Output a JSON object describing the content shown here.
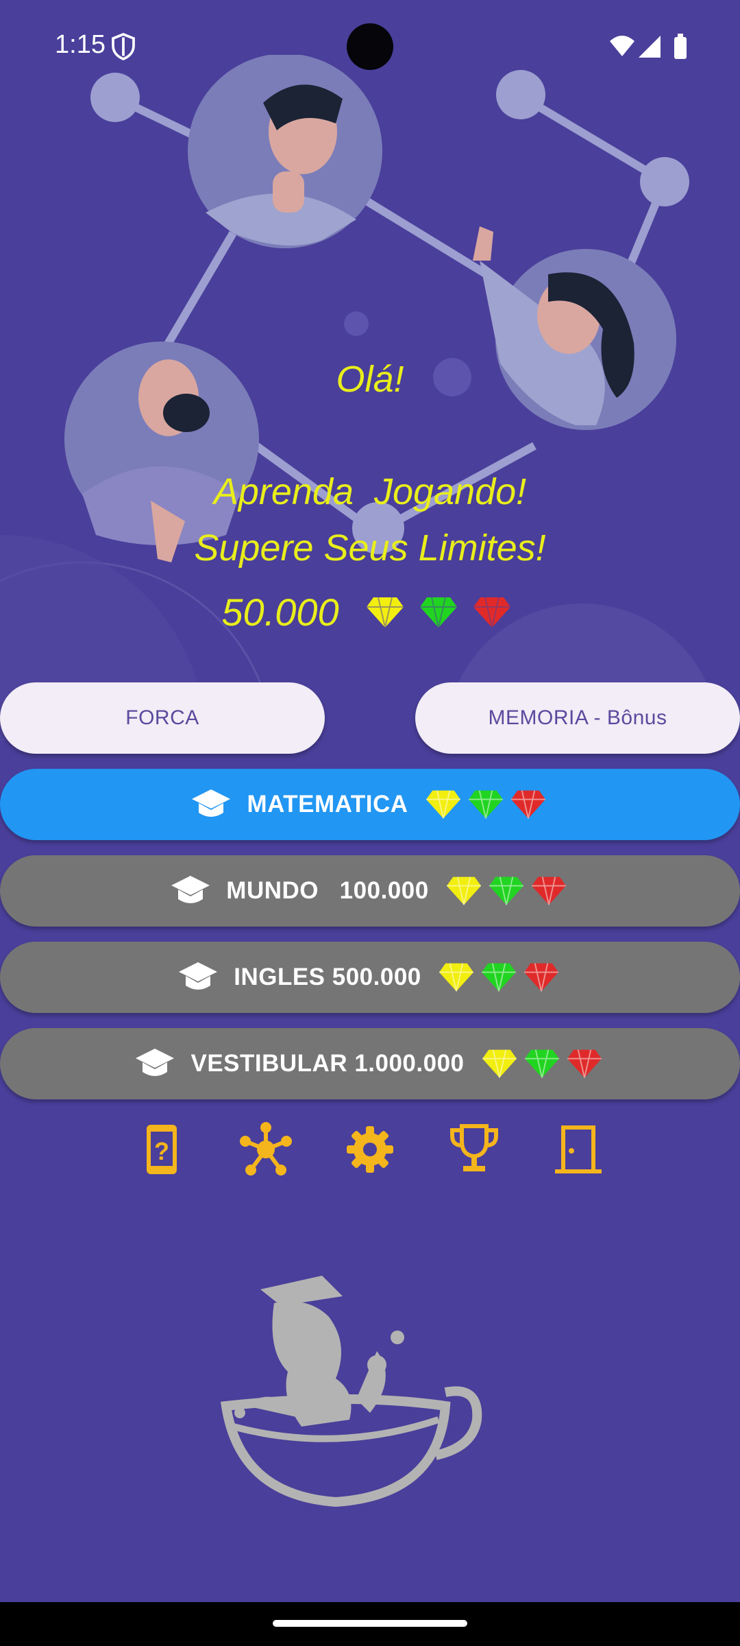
{
  "status_bar": {
    "time": "1:15"
  },
  "hero": {
    "greeting": "Olá!",
    "tagline_1": "Aprenda  Jogando!",
    "tagline_2": "Supere Seus Limites!",
    "score": "50.000"
  },
  "buttons": {
    "forca": "FORCA",
    "memoria": "MEMORIA - Bônus"
  },
  "categories": [
    {
      "label": "MATEMATICA",
      "color": "#2196f3"
    },
    {
      "label": "MUNDO   100.000",
      "color": "#757575"
    },
    {
      "label": "INGLES 500.000",
      "color": "#757575"
    },
    {
      "label": "VESTIBULAR 1.000.000",
      "color": "#757575"
    }
  ],
  "gem_colors": {
    "yellow": "#f2ee10",
    "green": "#21d421",
    "red": "#e02a2a"
  },
  "bottom_icons": [
    "phone-question-icon",
    "network-icon",
    "gear-icon",
    "trophy-icon",
    "door-exit-icon"
  ],
  "colors": {
    "background": "#4a3f9a",
    "accent_text": "#e9ee1b",
    "icon": "#f5b51c"
  }
}
